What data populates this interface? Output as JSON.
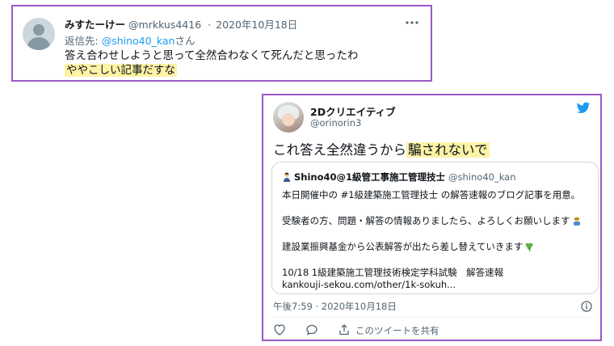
{
  "reply_tweet": {
    "display_name": "みすたーけー",
    "handle": "@mrkkus4416",
    "separator": "·",
    "date": "2020年10月18日",
    "menu_icon": "more-dots-icon",
    "reply_prefix": "返信先: ",
    "reply_mention": "@shino40_kan",
    "reply_suffix": "さん",
    "text_line1": "答え合わせしようと思って全然合わなくて死んだと思ったわ",
    "text_line2": "ややこしい記事だすな"
  },
  "main_tweet": {
    "display_name": "2Dクリエイティブ",
    "handle": "@orinorin3",
    "brand_icon": "twitter-bird-icon",
    "brand_color": "#1d9bf0",
    "text_plain": "これ答え全然違うから",
    "text_highlight": "騙されないで",
    "quote": {
      "author_emoji": "person-emoji-icon",
      "display_name": "Shino40@1級管工事施工管理技士",
      "handle": "@shino40_kan",
      "line1": "本日開催中の #1級建築施工管理技士 の解答速報のブログ記事を用意。",
      "line2": "受験者の方、問題・解答の情報ありましたら、よろしくお願いします",
      "line2_emoji": "bowing-person-emoji-icon",
      "line3": "建設業振興基金から公表解答が出たら差し替えていきます",
      "line3_emoji": "shamrock-emoji-icon",
      "line4": "10/18 1級建築施工管理技術検定学科試験　解答速報",
      "url": "kankouji-sekou.com/other/1k-sokuh..."
    },
    "timestamp": "午後7:59 · 2020年10月18日",
    "actions": {
      "like_icon": "heart-icon",
      "reply_icon": "comment-icon",
      "share_icon": "share-icon",
      "share_label": "このツイートを共有"
    }
  },
  "colors": {
    "frame_border": "#9b59c6",
    "highlight": "#fdf3a6",
    "link": "#1d9bf0",
    "secondary_text": "#536471"
  }
}
